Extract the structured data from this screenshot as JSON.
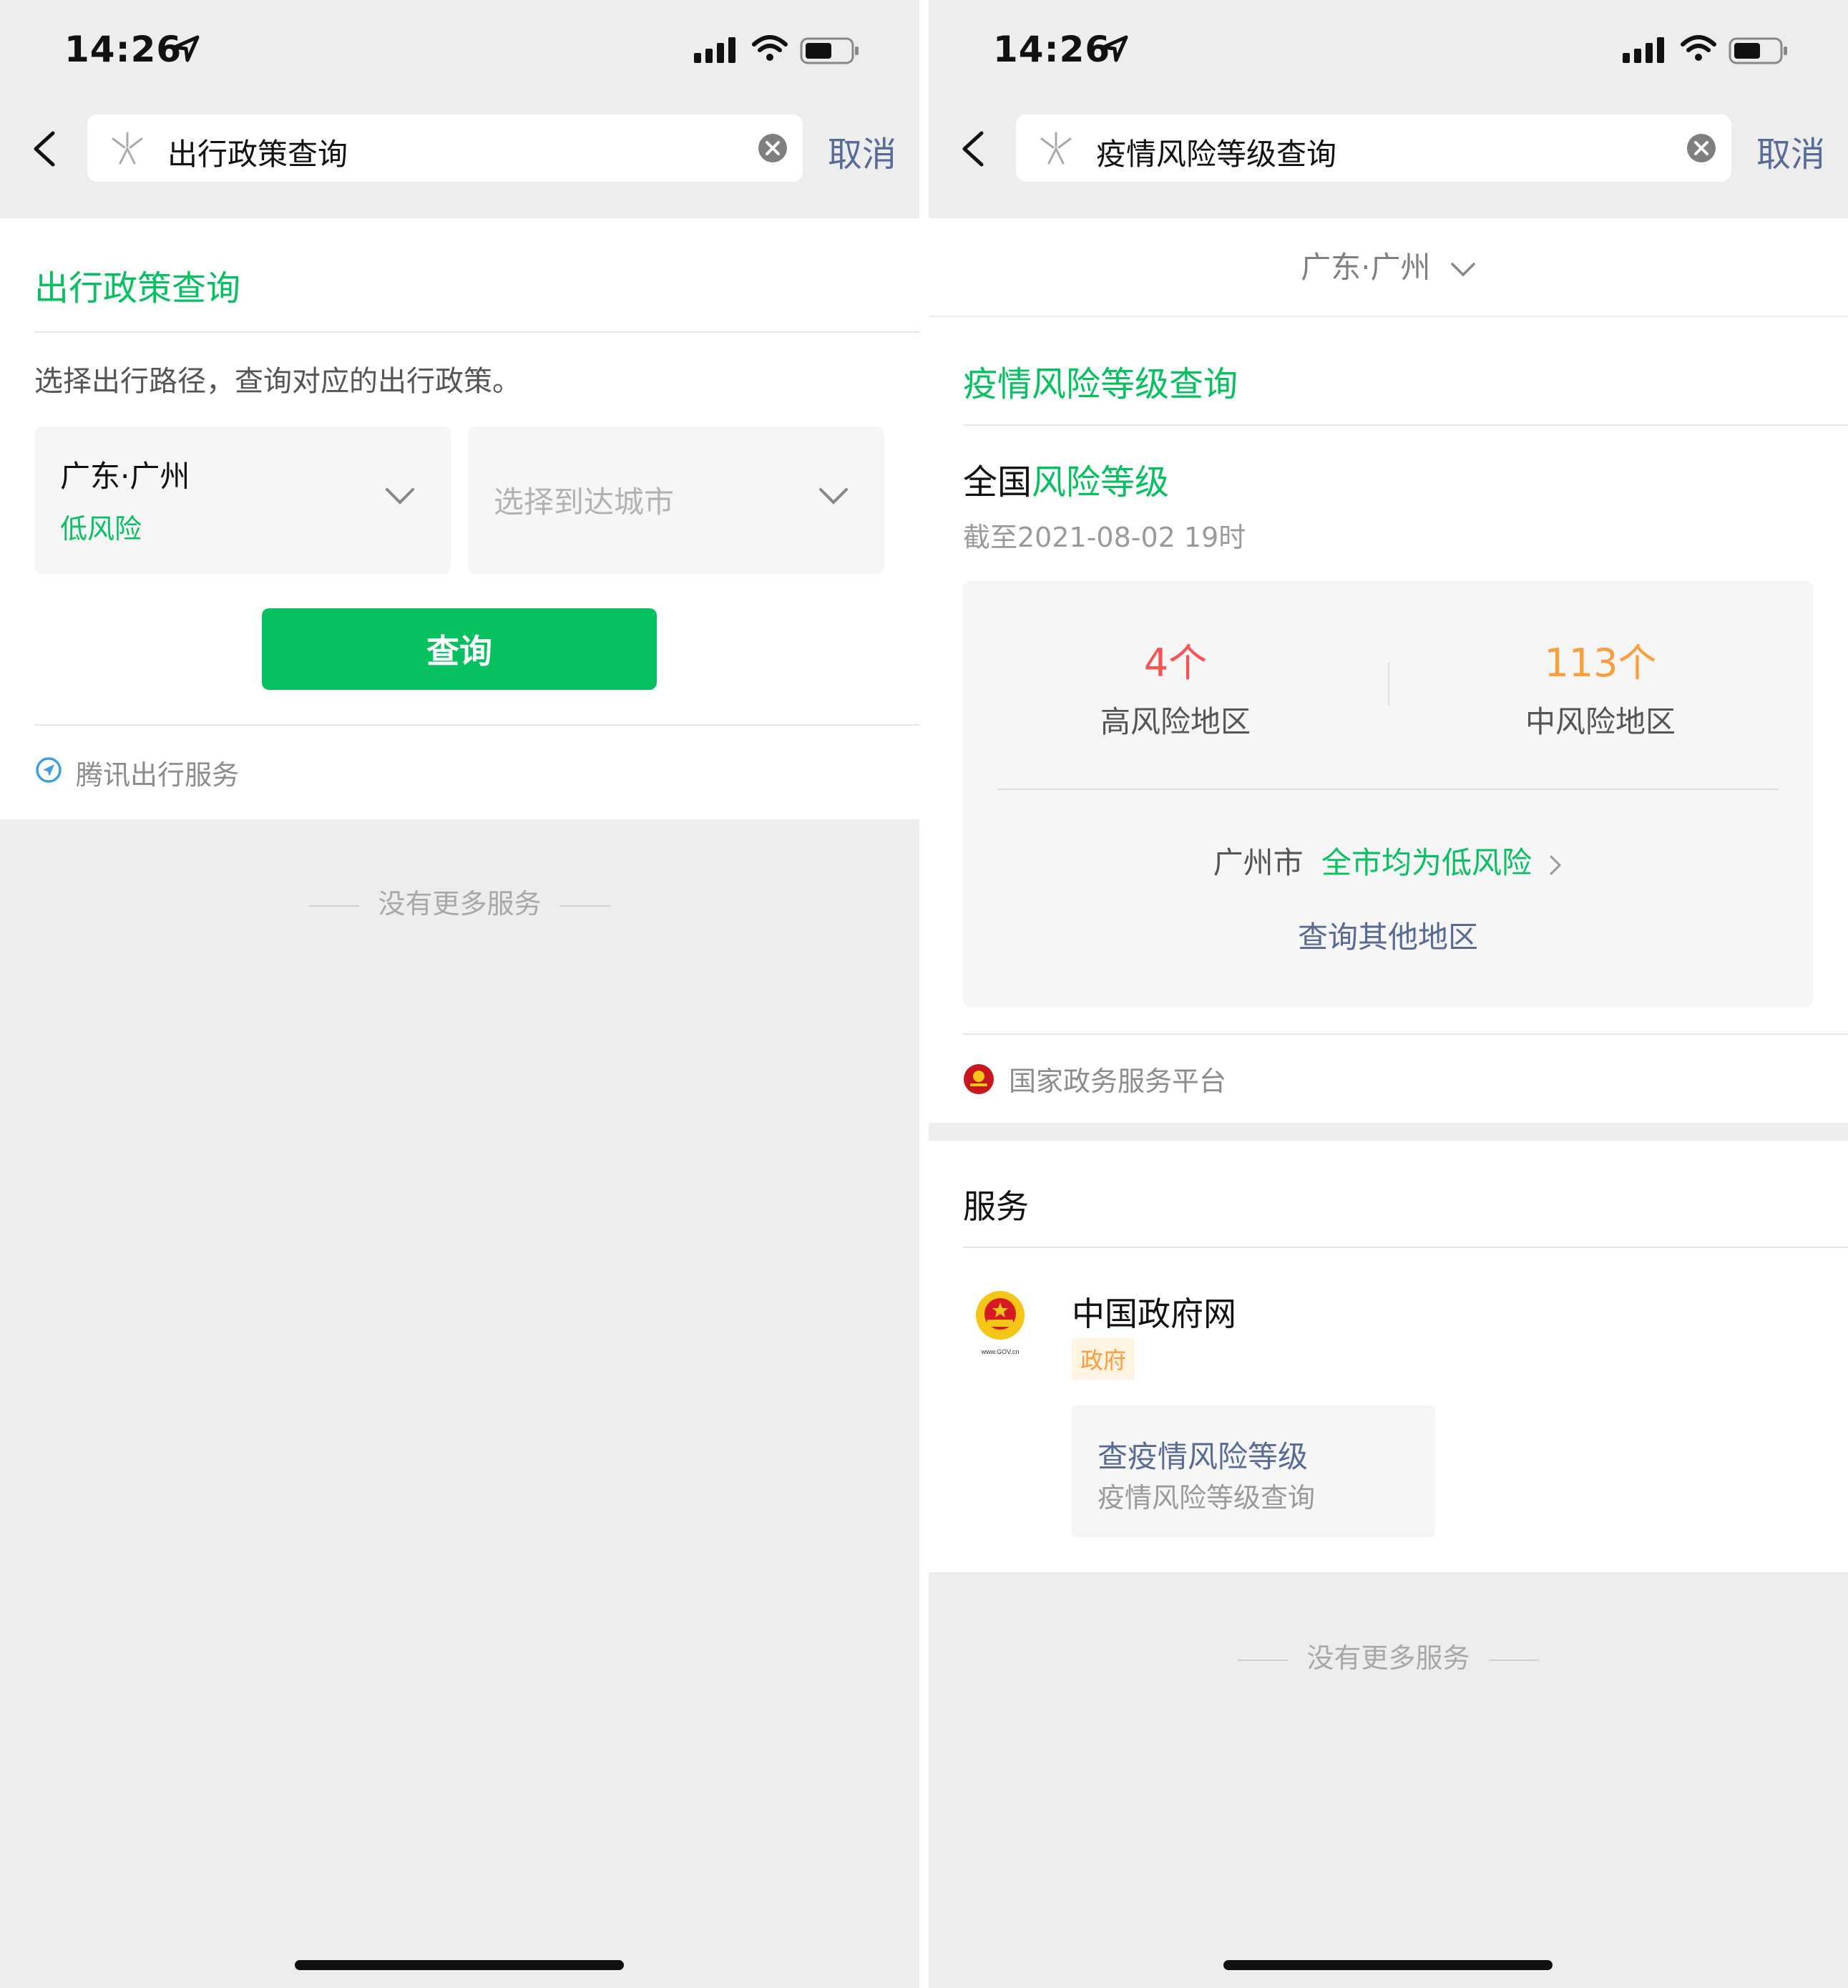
{
  "status": {
    "time": "14:26"
  },
  "left": {
    "search_text": "出行政策查询",
    "cancel": "取消",
    "title": "出行政策查询",
    "description": "选择出行路径，查询对应的出行政策。",
    "from_city": "广东·广州",
    "from_risk": "低风险",
    "to_placeholder": "选择到达城市",
    "query_button": "查询",
    "provider": "腾讯出行服务",
    "no_more": "没有更多服务"
  },
  "right": {
    "search_text": "疫情风险等级查询",
    "cancel": "取消",
    "location": "广东·广州",
    "title": "疫情风险等级查询",
    "national_prefix": "全国",
    "national_suffix": "风险等级",
    "as_of": "截至2021-08-02 19时",
    "high_count": "4个",
    "high_label": "高风险地区",
    "mid_count": "113个",
    "mid_label": "中风险地区",
    "city_name": "广州市",
    "city_status": "全市均为低风险",
    "query_other": "查询其他地区",
    "source": "国家政务服务平台",
    "services_title": "服务",
    "app_name": "中国政府网",
    "app_tag": "政府",
    "gov_logo_text": "www.GOV.cn",
    "svc_title": "查疫情风险等级",
    "svc_subtitle": "疫情风险等级查询",
    "no_more": "没有更多服务"
  },
  "colors": {
    "green": "#07c160",
    "link": "#576b95",
    "high": "#fa5151",
    "mid": "#fa9d3b"
  }
}
